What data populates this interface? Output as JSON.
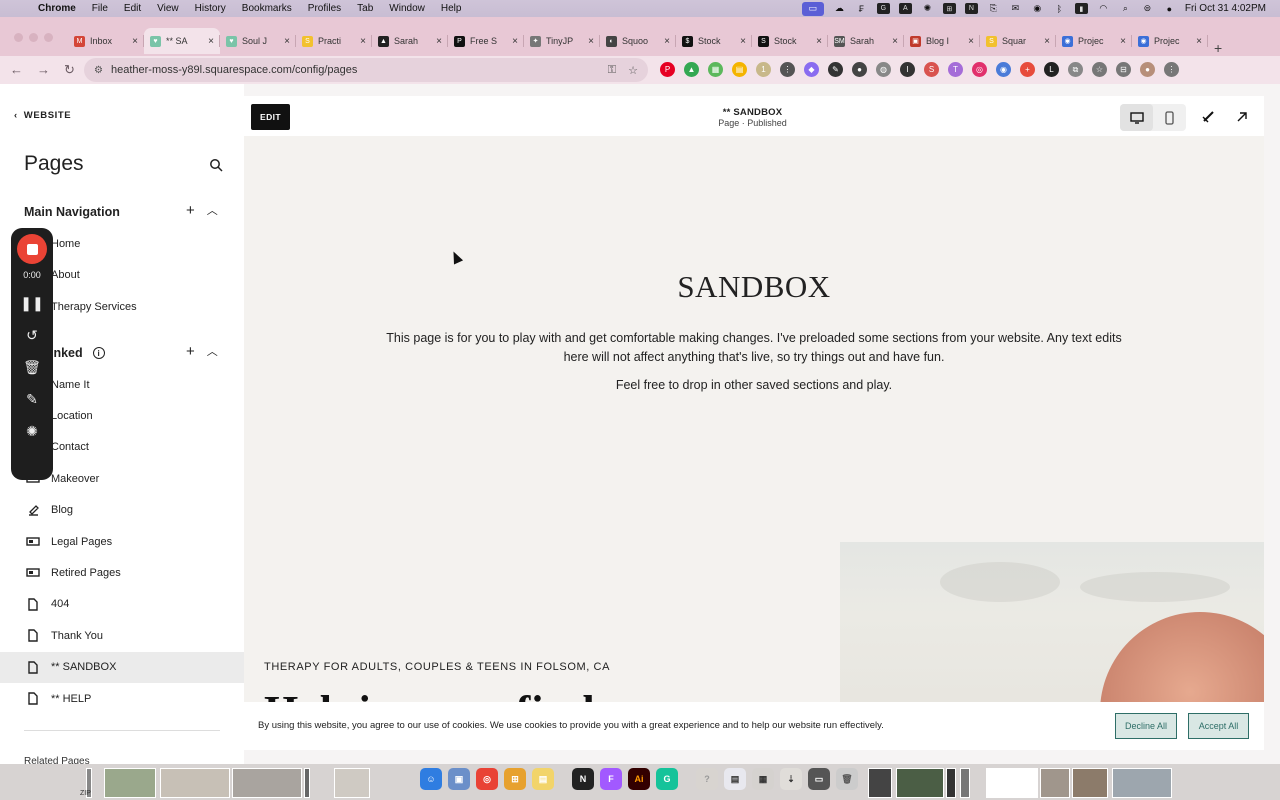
{
  "menubar": {
    "apple_glyph": "",
    "items": [
      "Chrome",
      "File",
      "Edit",
      "View",
      "History",
      "Bookmarks",
      "Profiles",
      "Tab",
      "Window",
      "Help"
    ],
    "clock": "Fri Oct 31  4:02PM"
  },
  "tabs": [
    {
      "label": "Inbox",
      "color": "#d44638",
      "glyph": "M"
    },
    {
      "label": "** SA",
      "color": "#7ac4a8",
      "glyph": "♥"
    },
    {
      "label": "Soul J",
      "color": "#7ac4a8",
      "glyph": "♥"
    },
    {
      "label": "Practi",
      "color": "#f2c12e",
      "glyph": "S"
    },
    {
      "label": "Sarah",
      "color": "#222222",
      "glyph": "▲"
    },
    {
      "label": "Free S",
      "color": "#111111",
      "glyph": "P"
    },
    {
      "label": "TinyJP",
      "color": "#777777",
      "glyph": "✦"
    },
    {
      "label": "Squoo",
      "color": "#444444",
      "glyph": "◐"
    },
    {
      "label": "Stock",
      "color": "#111111",
      "glyph": "$"
    },
    {
      "label": "Stock",
      "color": "#111111",
      "glyph": "S"
    },
    {
      "label": "Sarah",
      "color": "#555555",
      "glyph": "SM"
    },
    {
      "label": "Blog I",
      "color": "#c0392b",
      "glyph": "▣"
    },
    {
      "label": "Squar",
      "color": "#f2c12e",
      "glyph": "S"
    },
    {
      "label": "Projec",
      "color": "#3b6fd8",
      "glyph": "◉"
    },
    {
      "label": "Projec",
      "color": "#3b6fd8",
      "glyph": "◉"
    }
  ],
  "address": {
    "url": "heather-moss-y89l.squarespace.com/config/pages"
  },
  "sidebar": {
    "back_label": "WEBSITE",
    "title": "Pages",
    "main_nav": {
      "label": "Main Navigation",
      "items": [
        "Home",
        "About",
        "Therapy Services"
      ]
    },
    "not_linked": {
      "label": "inked",
      "items": [
        {
          "label": "Name It",
          "icon": "none"
        },
        {
          "label": "Location",
          "icon": "none"
        },
        {
          "label": "Contact",
          "icon": "none"
        },
        {
          "label": "Makeover",
          "icon": "folder-icon"
        },
        {
          "label": "Blog",
          "icon": "blog-icon"
        },
        {
          "label": "Legal Pages",
          "icon": "folder-icon"
        },
        {
          "label": "Retired Pages",
          "icon": "folder-icon"
        },
        {
          "label": "404",
          "icon": "page-icon"
        },
        {
          "label": "Thank You",
          "icon": "page-icon"
        },
        {
          "label": "** SANDBOX",
          "icon": "page-icon",
          "selected": true
        },
        {
          "label": "** HELP",
          "icon": "page-icon"
        }
      ]
    },
    "related": "Related Pages"
  },
  "recorder": {
    "time": "0:00"
  },
  "editor": {
    "edit_label": "EDIT",
    "page_title": "** SANDBOX",
    "page_status": "Page · Published"
  },
  "page": {
    "hero_title": "SANDBOX",
    "hero_text": "This page is for you to play with and get comfortable making changes. I've preloaded some sections from your website. Any text edits here will not affect anything that's live, so try things out and have fun.",
    "hero_text2": "Feel free to drop in other saved sections and play.",
    "eyebrow": "THERAPY FOR ADULTS, COUPLES & TEENS IN FOLSOM, CA",
    "big_heading": "Helping you find"
  },
  "cookie": {
    "message": "By using this website, you agree to our use of cookies. We use cookies to provide you with a great experience and to help our website run effectively.",
    "decline": "Decline All",
    "accept": "Accept All"
  },
  "dock": {
    "zip_label": "ZIP"
  }
}
